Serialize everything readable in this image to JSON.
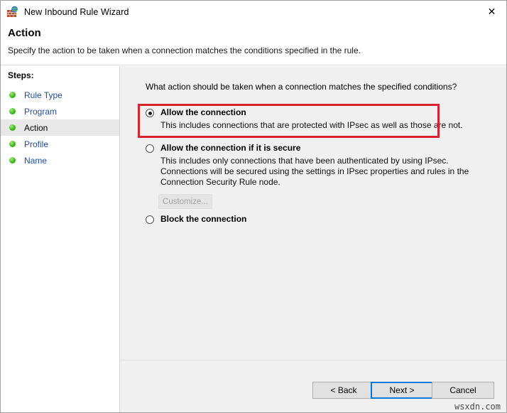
{
  "window": {
    "title": "New Inbound Rule Wizard",
    "icon": "firewall-globe-icon",
    "close_label": "✕"
  },
  "header": {
    "title": "Action",
    "subtitle": "Specify the action to be taken when a connection matches the conditions specified in the rule."
  },
  "sidebar": {
    "heading": "Steps:",
    "items": [
      {
        "label": "Rule Type",
        "current": false
      },
      {
        "label": "Program",
        "current": false
      },
      {
        "label": "Action",
        "current": true
      },
      {
        "label": "Profile",
        "current": false
      },
      {
        "label": "Name",
        "current": false
      }
    ]
  },
  "main": {
    "question": "What action should be taken when a connection matches the specified conditions?",
    "options": [
      {
        "id": "allow",
        "title": "Allow the connection",
        "description": "This includes connections that are protected with IPsec as well as those are not.",
        "selected": true,
        "highlighted": true
      },
      {
        "id": "allow-if-secure",
        "title": "Allow the connection if it is secure",
        "description": "This includes only connections that have been authenticated by using IPsec.  Connections will be secured using the settings in IPsec properties and rules in the Connection Security Rule node.",
        "selected": false,
        "highlighted": false
      },
      {
        "id": "block",
        "title": "Block the connection",
        "description": "",
        "selected": false,
        "highlighted": false
      }
    ],
    "customize_button": {
      "label": "Customize...",
      "enabled": false
    }
  },
  "footer": {
    "back_label": "< Back",
    "next_label": "Next >",
    "cancel_label": "Cancel"
  },
  "watermark": "wsxdn.com",
  "colors": {
    "highlight_red": "#d8232f",
    "focus_blue": "#0078d7",
    "link_blue": "#1f4e9c",
    "bullet_green": "#49c222",
    "content_bg": "#f0f0f0"
  }
}
